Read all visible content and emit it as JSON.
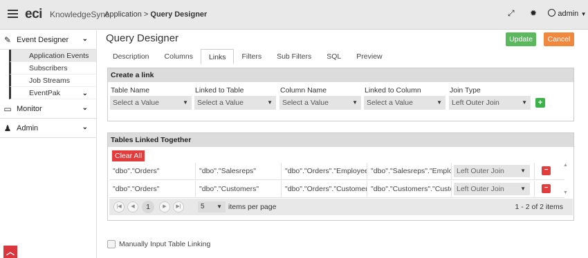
{
  "header": {
    "logo_eci": "eci",
    "logo_product": "KnowledgeSync",
    "breadcrumb_root": "Application",
    "breadcrumb_sep": ">",
    "breadcrumb_page": "Query Designer",
    "user": "admin"
  },
  "sidebar": {
    "event_designer": "Event Designer",
    "sub_items": [
      "Application Events",
      "Subscribers",
      "Job Streams",
      "EventPak"
    ],
    "monitor": "Monitor",
    "admin": "Admin"
  },
  "main": {
    "title": "Query Designer",
    "update_label": "Update",
    "cancel_label": "Cancel",
    "tabs": [
      "Description",
      "Columns",
      "Links",
      "Filters",
      "Sub Filters",
      "SQL",
      "Preview"
    ],
    "active_tab": "Links"
  },
  "create_link": {
    "heading": "Create a link",
    "labels": [
      "Table Name",
      "Linked to Table",
      "Column Name",
      "Linked to Column",
      "Join Type"
    ],
    "values": [
      "Select a Value",
      "Select a Value",
      "Select a Value",
      "Select a Value",
      "Left Outer Join"
    ]
  },
  "linked": {
    "heading": "Tables Linked Together",
    "clear_all": "Clear All",
    "rows": [
      [
        "\"dbo\".\"Orders\"",
        "\"dbo\".\"Salesreps\"",
        "\"dbo\".\"Orders\".\"Employee...",
        "\"dbo\".\"Salesreps\".\"Employ...",
        "Left Outer Join"
      ],
      [
        "\"dbo\".\"Orders\"",
        "\"dbo\".\"Customers\"",
        "\"dbo\".\"Orders\".\"Customerl...",
        "\"dbo\".\"Customers\".\"Custo...",
        "Left Outer Join"
      ]
    ]
  },
  "pager": {
    "current_page": "1",
    "page_size": "5",
    "items_per_page": "items per page",
    "summary": "1 - 2 of 2 items"
  },
  "manual_linking": "Manually Input Table Linking",
  "colors": {
    "update": "#5cb85c",
    "cancel": "#f0883e",
    "add": "#3eb24a",
    "delete": "#e33c3c"
  }
}
